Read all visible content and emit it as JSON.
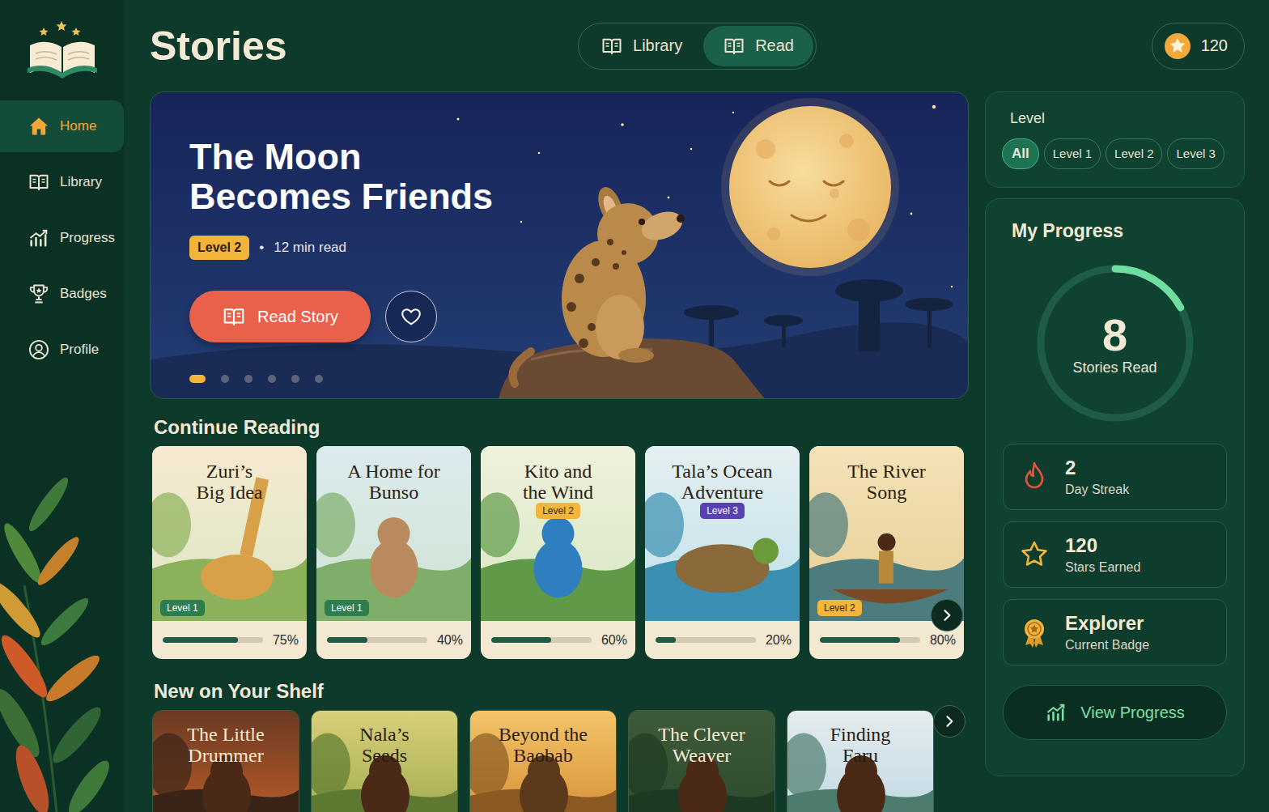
{
  "header": {
    "title": "Stories",
    "tabs": [
      {
        "label": "Library",
        "selected": false
      },
      {
        "label": "Read",
        "selected": true
      }
    ],
    "stars": "120"
  },
  "sidebar": {
    "items": [
      {
        "label": "Home",
        "selected": true
      },
      {
        "label": "Library",
        "selected": false
      },
      {
        "label": "Progress",
        "selected": false
      },
      {
        "label": "Badges",
        "selected": false
      },
      {
        "label": "Profile",
        "selected": false
      }
    ]
  },
  "hero": {
    "title_lines": [
      "The Moon",
      "Becomes Friends"
    ],
    "level": "Level 2",
    "separator": "•",
    "read_time": "12 min read",
    "button": "Read Story",
    "favorite": false,
    "dots": [
      {
        "selected": true
      },
      {
        "selected": false
      },
      {
        "selected": false
      },
      {
        "selected": false
      },
      {
        "selected": false
      },
      {
        "selected": false
      }
    ]
  },
  "level_filter": {
    "label": "Level",
    "options": [
      {
        "label": "All",
        "selected": true
      },
      {
        "label": "Level 1",
        "selected": false
      },
      {
        "label": "Level 2",
        "selected": false
      },
      {
        "label": "Level 3",
        "selected": false
      }
    ]
  },
  "progress": {
    "title": "My Progress",
    "count": "8",
    "caption": "Stories Read",
    "level": 0.17,
    "stats": [
      {
        "kind": "streak",
        "value": "2",
        "label": "Day Streak"
      },
      {
        "kind": "stars",
        "value": "120",
        "label": "Stars Earned"
      },
      {
        "kind": "badge",
        "value": "Explorer",
        "label": "Current Badge"
      }
    ],
    "button": "View Progress"
  },
  "continue_reading": {
    "title": "Continue Reading",
    "books": [
      {
        "title_lines": [
          "Zuri’s",
          "Big Idea"
        ],
        "tag": {
          "text": "Level 1",
          "color": "#2e7d4f",
          "kind": "corner"
        },
        "level": 0.75,
        "percent": "75%"
      },
      {
        "title_lines": [
          "A Home for",
          "Bunso"
        ],
        "tag": {
          "text": "Level 1",
          "color": "#2e7d4f",
          "kind": "corner"
        },
        "level": 0.4,
        "percent": "40%"
      },
      {
        "title_lines": [
          "Kito and",
          "the Wind"
        ],
        "tag": {
          "text": "Level 2",
          "color": "#f2b63c",
          "kind": "title"
        },
        "level": 0.6,
        "percent": "60%"
      },
      {
        "title_lines": [
          "Tala’s Ocean",
          "Adventure"
        ],
        "tag": {
          "text": "Level 3",
          "color": "#5b3fb5",
          "kind": "title"
        },
        "level": 0.2,
        "percent": "20%"
      },
      {
        "title_lines": [
          "The River",
          "Song"
        ],
        "tag": {
          "text": "Level 2",
          "color": "#f2b63c",
          "kind": "corner"
        },
        "level": 0.8,
        "percent": "80%"
      }
    ]
  },
  "new_on_shelf": {
    "title": "New on Your Shelf",
    "books": [
      {
        "title_lines": [
          "The Little",
          "Drummer"
        ]
      },
      {
        "title_lines": [
          "Nala’s",
          "Seeds"
        ]
      },
      {
        "title_lines": [
          "Beyond the",
          "Baobab"
        ]
      },
      {
        "title_lines": [
          "The Clever",
          "Weaver"
        ]
      },
      {
        "title_lines": [
          "Finding",
          "Faru"
        ]
      }
    ]
  }
}
